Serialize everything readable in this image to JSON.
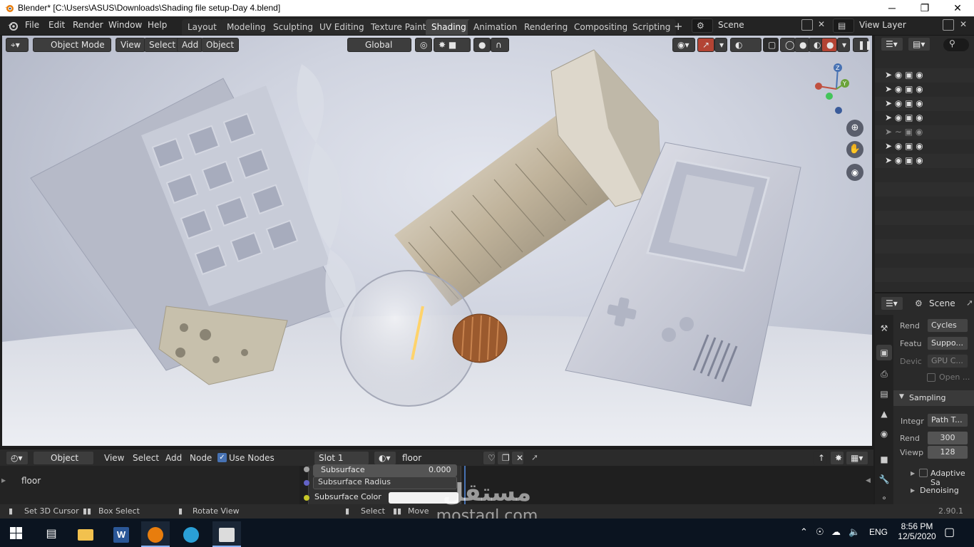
{
  "window": {
    "title": "Blender* [C:\\Users\\ASUS\\Downloads\\Shading file setup-Day 4.blend]",
    "min_glyph": "─",
    "max_glyph": "❐",
    "close_glyph": "✕"
  },
  "menu": [
    "File",
    "Edit",
    "Render",
    "Window",
    "Help"
  ],
  "workspace_tabs": [
    "Layout",
    "Modeling",
    "Sculpting",
    "UV Editing",
    "Texture Paint",
    "Shading",
    "Animation",
    "Rendering",
    "Compositing",
    "Scripting"
  ],
  "active_tab": "Shading",
  "add_tab_glyph": "+",
  "scene": {
    "name": "Scene",
    "view_layer": "View Layer"
  },
  "viewport_header": {
    "mode": "Object Mode",
    "menus": [
      "View",
      "Select",
      "Add",
      "Object"
    ],
    "transform_orientation": "Global"
  },
  "outliner_rows": 7,
  "properties": {
    "scene_label": "Scene",
    "render_engine_label": "Rend",
    "render_engine_value": "Cycles",
    "feature_label": "Featu",
    "feature_value": "Suppo...",
    "device_label": "Devic",
    "device_value": "GPU C...",
    "open_label": "Open ...",
    "sampling_label": "Sampling",
    "integrator_label": "Integr",
    "integrator_value": "Path T...",
    "render_label": "Rend",
    "render_samples": "300",
    "viewport_label": "Viewp",
    "viewport_samples": "128",
    "adaptive_label": "Adaptive Sa",
    "denoising_label": "Denoising"
  },
  "node_header": {
    "editor_type": "Object",
    "menus": [
      "View",
      "Select",
      "Add",
      "Node"
    ],
    "use_nodes": "Use Nodes",
    "slot": "Slot 1",
    "material": "floor"
  },
  "node_panel": {
    "selected": "floor",
    "subsurface_label": "Subsurface",
    "subsurface_value": "0.000",
    "subsurface_radius": "Subsurface Radius",
    "subsurface_color": "Subsurface Color"
  },
  "statusbar": {
    "set_cursor": "Set 3D Cursor",
    "box_select": "Box Select",
    "rotate_view": "Rotate View",
    "select": "Select",
    "move": "Move",
    "version": "2.90.1"
  },
  "taskbar": {
    "time": "8:56 PM",
    "date": "12/5/2020",
    "lang": "ENG"
  },
  "watermark": {
    "arabic": "مستقل",
    "latin": "mostaql.com"
  },
  "colors": {
    "accent_blue": "#4772b3",
    "active_red": "#b34434",
    "taskbar": "#0b1420"
  }
}
